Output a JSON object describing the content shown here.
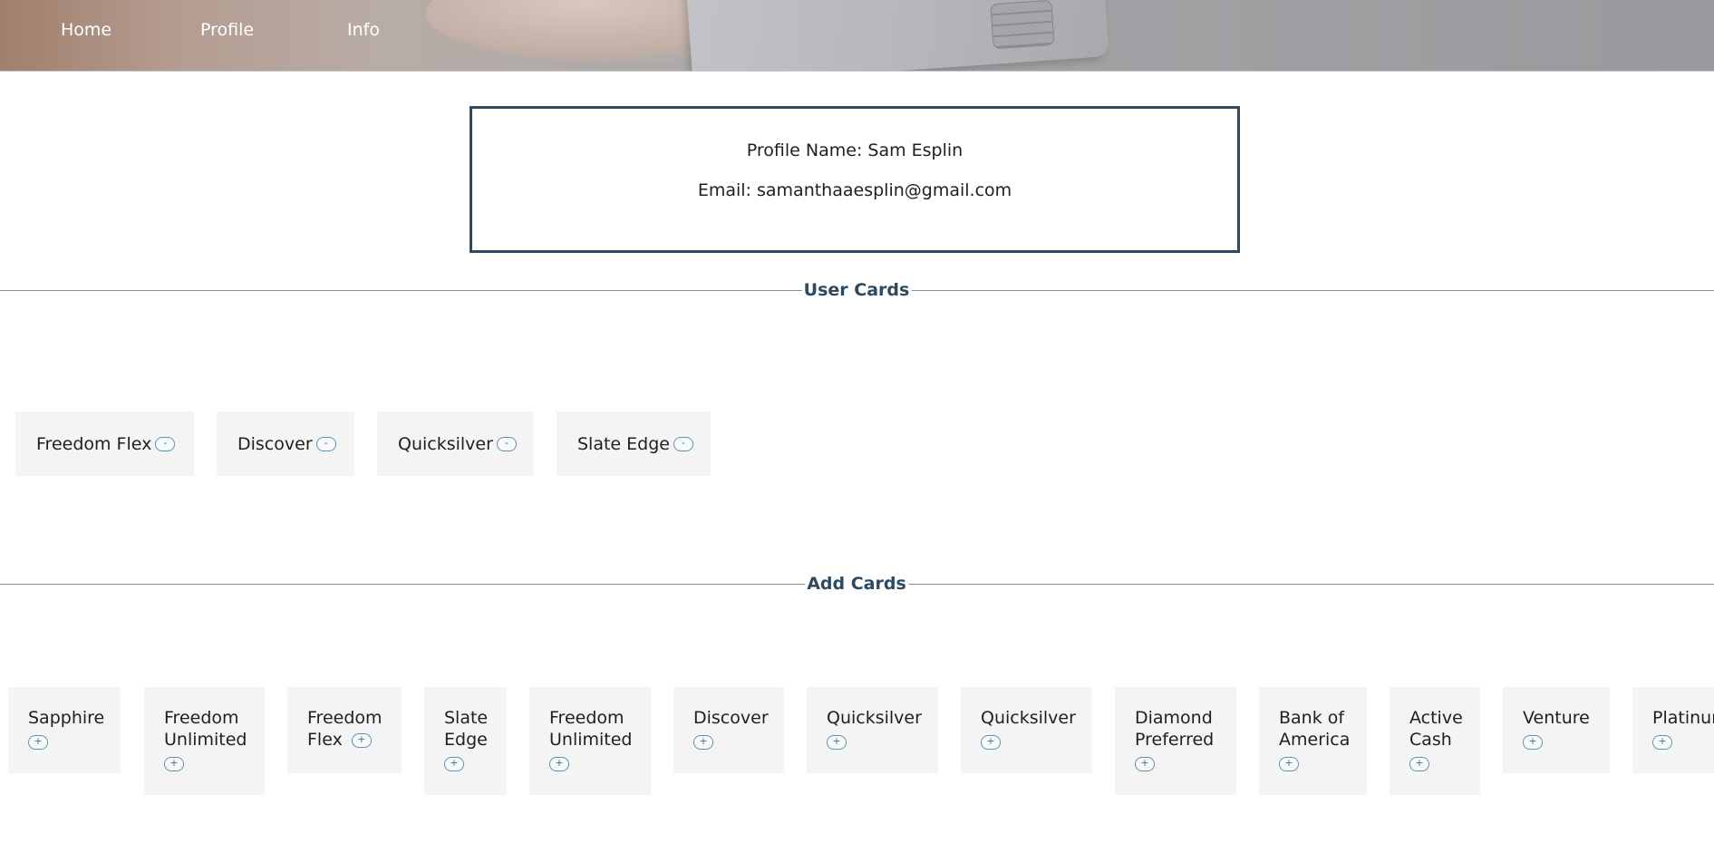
{
  "nav": {
    "home": "Home",
    "profile": "Profile",
    "info": "Info"
  },
  "profile": {
    "name_line": "Profile Name: Sam Esplin",
    "email_line": "Email: samanthaaesplin@gmail.com"
  },
  "user_cards": {
    "title": "User Cards",
    "remove_label": "-",
    "items": [
      "Freedom Flex",
      "Discover",
      "Quicksilver",
      "Slate Edge"
    ]
  },
  "add_cards": {
    "title": "Add Cards",
    "add_label": "+",
    "items": [
      {
        "line1": "Sapphire",
        "line2": ""
      },
      {
        "line1": "Freedom",
        "line2": "Unlimited"
      },
      {
        "line1": "Freedom",
        "line2": "Flex"
      },
      {
        "line1": "Slate",
        "line2": "Edge"
      },
      {
        "line1": "Freedom",
        "line2": "Unlimited"
      },
      {
        "line1": "Discover",
        "line2": ""
      },
      {
        "line1": "Quicksilver",
        "line2": ""
      },
      {
        "line1": "Quicksilver",
        "line2": ""
      },
      {
        "line1": "Diamond",
        "line2": "Preferred"
      },
      {
        "line1": "Bank of",
        "line2": "America"
      },
      {
        "line1": "Active",
        "line2": "Cash"
      },
      {
        "line1": "Venture",
        "line2": ""
      },
      {
        "line1": "Platinum",
        "line2": ""
      }
    ]
  },
  "colors": {
    "accent": "#2c4a61",
    "button_border": "#5d93ad",
    "card_bg": "#f4f4f4"
  }
}
